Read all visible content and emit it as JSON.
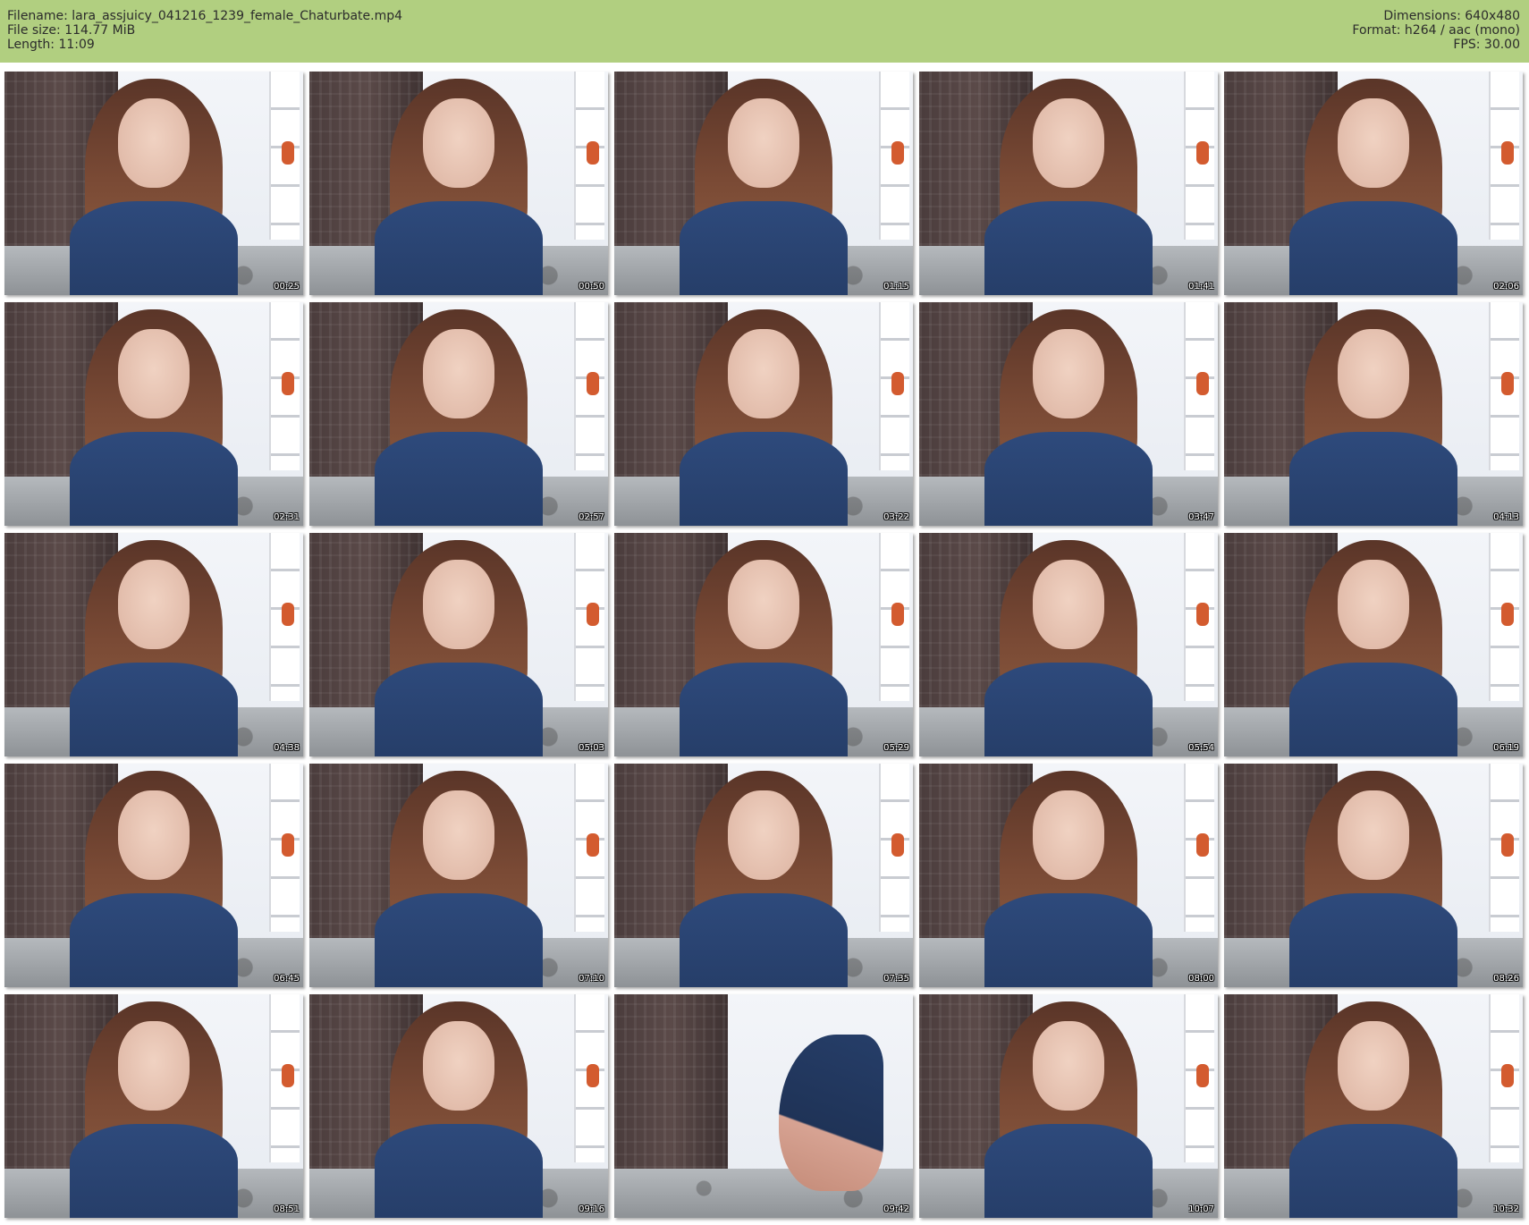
{
  "header": {
    "filename": "Filename: lara_assjuicy_041216_1239_female_Chaturbate.mp4",
    "filesize": "File size: 114.77 MiB",
    "length": "Length: 11:09",
    "dimensions": "Dimensions: 640x480",
    "format": "Format: h264 / aac (mono)",
    "fps": "FPS: 30.00"
  },
  "colors": {
    "header_bg": "#b1cf80",
    "page_bg": "#ffffff"
  },
  "thumbnails": [
    {
      "timestamp": "00:25"
    },
    {
      "timestamp": "00:50"
    },
    {
      "timestamp": "01:15"
    },
    {
      "timestamp": "01:41"
    },
    {
      "timestamp": "02:06"
    },
    {
      "timestamp": "02:31"
    },
    {
      "timestamp": "02:57"
    },
    {
      "timestamp": "03:22"
    },
    {
      "timestamp": "03:47"
    },
    {
      "timestamp": "04:13"
    },
    {
      "timestamp": "04:38"
    },
    {
      "timestamp": "05:03"
    },
    {
      "timestamp": "05:29"
    },
    {
      "timestamp": "05:54"
    },
    {
      "timestamp": "06:19"
    },
    {
      "timestamp": "06:45"
    },
    {
      "timestamp": "07:10"
    },
    {
      "timestamp": "07:35"
    },
    {
      "timestamp": "08:00"
    },
    {
      "timestamp": "08:26"
    },
    {
      "timestamp": "08:51"
    },
    {
      "timestamp": "09:16"
    },
    {
      "timestamp": "09:42"
    },
    {
      "timestamp": "10:07"
    },
    {
      "timestamp": "10:32"
    }
  ]
}
